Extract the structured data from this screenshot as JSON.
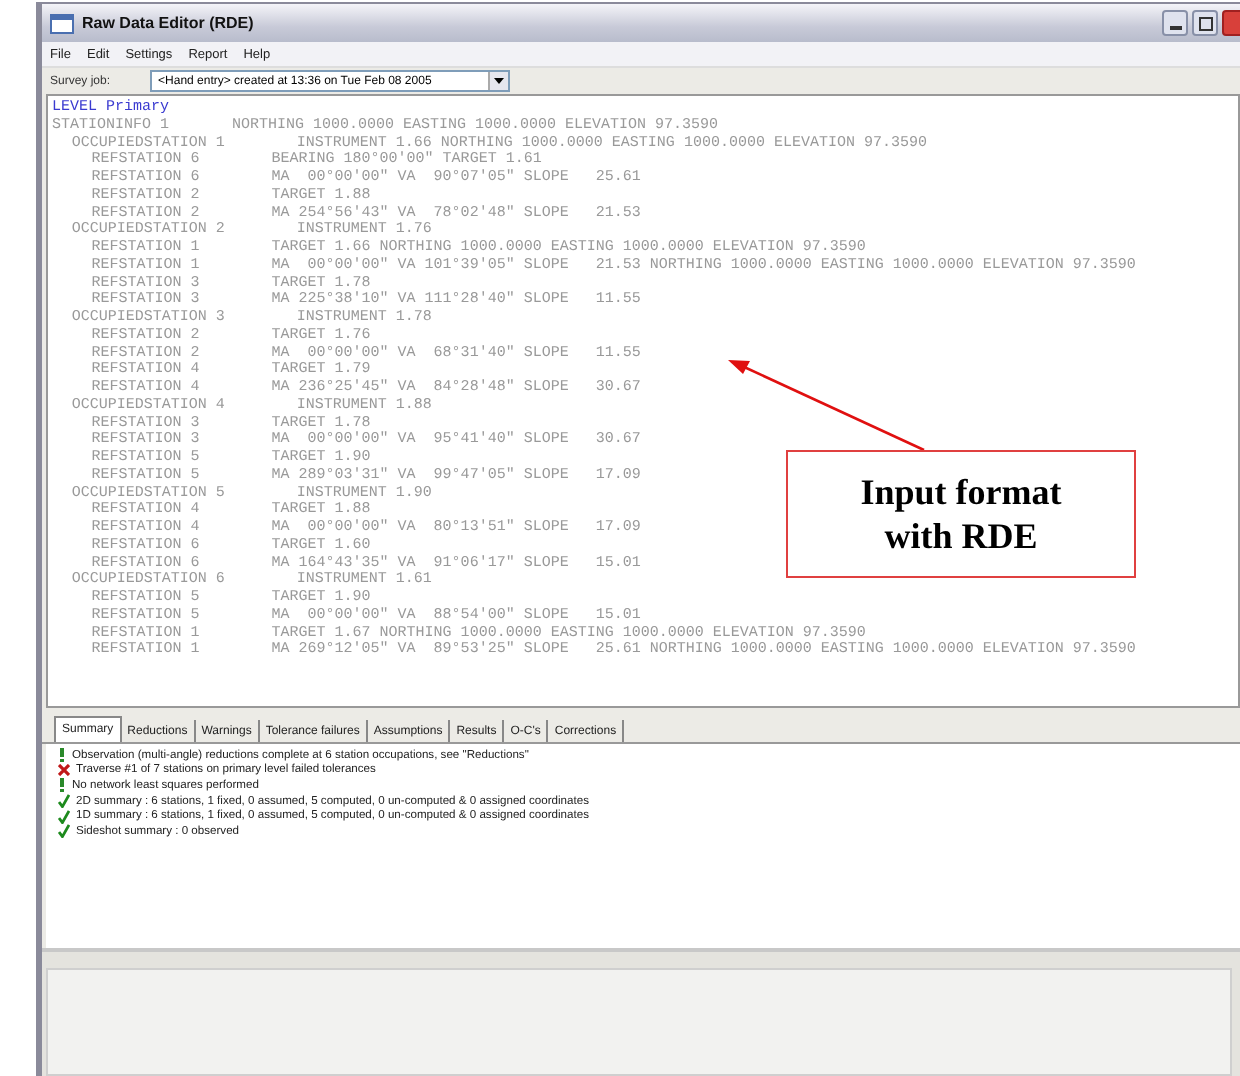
{
  "window": {
    "title": "Raw Data Editor (RDE)"
  },
  "menu": [
    "File",
    "Edit",
    "Settings",
    "Report",
    "Help"
  ],
  "survey_job": {
    "label": "Survey job:",
    "value": "<Hand entry> created at 13:36 on Tue Feb 08 2005"
  },
  "editor": {
    "header": "LEVEL Primary",
    "lines": [
      {
        "label": "STATIONINFO 1",
        "value": "NORTHING 1000.0000 EASTING 1000.0000 ELEVATION 97.3590",
        "children": [
          {
            "label": "OCCUPIEDSTATION 1",
            "value": "INSTRUMENT 1.66 NORTHING 1000.0000 EASTING 1000.0000 ELEVATION 97.3590",
            "children": [
              {
                "label": "REFSTATION 6",
                "value": "BEARING 180°00'00\" TARGET 1.61"
              },
              {
                "label": "REFSTATION 6",
                "value": "MA  00°00'00\" VA  90°07'05\" SLOPE   25.61"
              },
              {
                "label": "REFSTATION 2",
                "value": "TARGET 1.88"
              },
              {
                "label": "REFSTATION 2",
                "value": "MA 254°56'43\" VA  78°02'48\" SLOPE   21.53"
              }
            ]
          },
          {
            "label": "OCCUPIEDSTATION 2",
            "value": "INSTRUMENT 1.76",
            "children": [
              {
                "label": "REFSTATION 1",
                "value": "TARGET 1.66 NORTHING 1000.0000 EASTING 1000.0000 ELEVATION 97.3590"
              },
              {
                "label": "REFSTATION 1",
                "value": "MA  00°00'00\" VA 101°39'05\" SLOPE   21.53 NORTHING 1000.0000 EASTING 1000.0000 ELEVATION 97.3590"
              },
              {
                "label": "REFSTATION 3",
                "value": "TARGET 1.78"
              },
              {
                "label": "REFSTATION 3",
                "value": "MA 225°38'10\" VA 111°28'40\" SLOPE   11.55"
              }
            ]
          },
          {
            "label": "OCCUPIEDSTATION 3",
            "value": "INSTRUMENT 1.78",
            "children": [
              {
                "label": "REFSTATION 2",
                "value": "TARGET 1.76"
              },
              {
                "label": "REFSTATION 2",
                "value": "MA  00°00'00\" VA  68°31'40\" SLOPE   11.55"
              },
              {
                "label": "REFSTATION 4",
                "value": "TARGET 1.79"
              },
              {
                "label": "REFSTATION 4",
                "value": "MA 236°25'45\" VA  84°28'48\" SLOPE   30.67"
              }
            ]
          },
          {
            "label": "OCCUPIEDSTATION 4",
            "value": "INSTRUMENT 1.88",
            "children": [
              {
                "label": "REFSTATION 3",
                "value": "TARGET 1.78"
              },
              {
                "label": "REFSTATION 3",
                "value": "MA  00°00'00\" VA  95°41'40\" SLOPE   30.67"
              },
              {
                "label": "REFSTATION 5",
                "value": "TARGET 1.90"
              },
              {
                "label": "REFSTATION 5",
                "value": "MA 289°03'31\" VA  99°47'05\" SLOPE   17.09"
              }
            ]
          },
          {
            "label": "OCCUPIEDSTATION 5",
            "value": "INSTRUMENT 1.90",
            "children": [
              {
                "label": "REFSTATION 4",
                "value": "TARGET 1.88"
              },
              {
                "label": "REFSTATION 4",
                "value": "MA  00°00'00\" VA  80°13'51\" SLOPE   17.09"
              },
              {
                "label": "REFSTATION 6",
                "value": "TARGET 1.60"
              },
              {
                "label": "REFSTATION 6",
                "value": "MA 164°43'35\" VA  91°06'17\" SLOPE   15.01"
              }
            ]
          },
          {
            "label": "OCCUPIEDSTATION 6",
            "value": "INSTRUMENT 1.61",
            "children": [
              {
                "label": "REFSTATION 5",
                "value": "TARGET 1.90"
              },
              {
                "label": "REFSTATION 5",
                "value": "MA  00°00'00\" VA  88°54'00\" SLOPE   15.01"
              },
              {
                "label": "REFSTATION 1",
                "value": "TARGET 1.67 NORTHING 1000.0000 EASTING 1000.0000 ELEVATION 97.3590"
              },
              {
                "label": "REFSTATION 1",
                "value": "MA 269°12'05\" VA  89°53'25\" SLOPE   25.61 NORTHING 1000.0000 EASTING 1000.0000 ELEVATION 97.3590"
              }
            ]
          }
        ]
      }
    ]
  },
  "tabs": [
    {
      "label": "Summary",
      "selected": true
    },
    {
      "label": "Reductions",
      "selected": false
    },
    {
      "label": "Warnings",
      "selected": false
    },
    {
      "label": "Tolerance failures",
      "selected": false
    },
    {
      "label": "Assumptions",
      "selected": false
    },
    {
      "label": "Results",
      "selected": false
    },
    {
      "label": "O-C's",
      "selected": false
    },
    {
      "label": "Corrections",
      "selected": false
    }
  ],
  "messages": [
    {
      "kind": "info",
      "text": "Observation (multi-angle) reductions complete at 6 station occupations, see \"Reductions\""
    },
    {
      "kind": "error",
      "text": "Traverse #1 of 7 stations on primary level failed tolerances"
    },
    {
      "kind": "info",
      "text": "No network least squares performed"
    },
    {
      "kind": "ok",
      "text": "2D summary : 6 stations, 1 fixed, 0 assumed, 5 computed, 0 un-computed & 0 assigned coordinates"
    },
    {
      "kind": "ok",
      "text": "1D summary : 6 stations, 1 fixed, 0 assumed, 5 computed, 0 un-computed & 0 assigned coordinates"
    },
    {
      "kind": "ok",
      "text": "Sideshot summary : 0 observed"
    }
  ],
  "annotation": {
    "text": "Input format with RDE"
  }
}
